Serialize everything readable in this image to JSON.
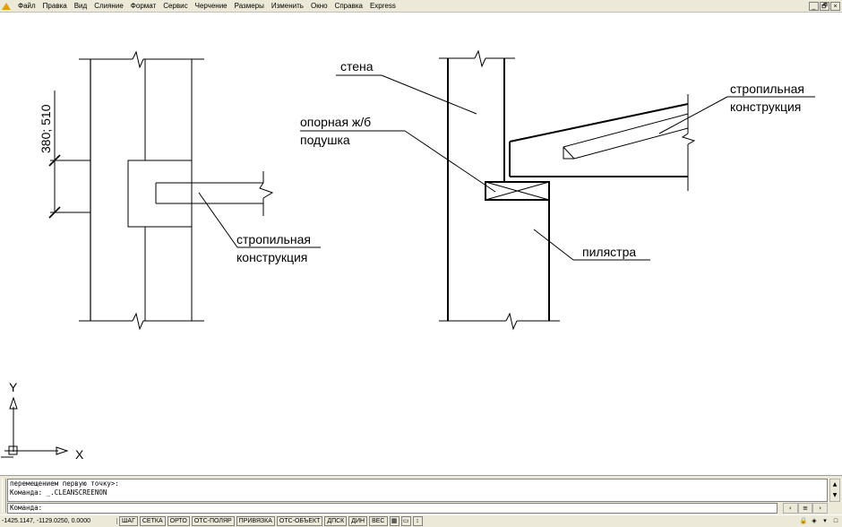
{
  "menu": {
    "items": [
      "Файл",
      "Правка",
      "Вид",
      "Слияние",
      "Формат",
      "Сервис",
      "Черчение",
      "Размеры",
      "Изменить",
      "Окно",
      "Справка",
      "Express"
    ],
    "window_controls": [
      "_",
      "🗗",
      "×"
    ]
  },
  "drawing": {
    "dimension_label": "380; 510",
    "left_label_line1": "стропильная",
    "left_label_line2": "конструкция",
    "wall_label": "стена",
    "pad_label_line1": "опорная ж/б",
    "pad_label_line2": "подушка",
    "right_label_line1": "стропильная",
    "right_label_line2": "конструкция",
    "pilaster_label": "пилястра",
    "ucs_x": "X",
    "ucs_y": "Y"
  },
  "command": {
    "history_line1": "перемещением первую точку>:",
    "history_line2": "Команда: _.CLEANSCREENON",
    "prompt": "Команда:"
  },
  "status": {
    "coordinates": "-1425.1147, -1129.0250, 0.0000",
    "toggles": [
      "ШАГ",
      "СЕТКА",
      "ОРТО",
      "ОТС-ПОЛЯР",
      "ПРИВЯЗКА",
      "ОТС-ОБЪЕКТ",
      "ДПСК",
      "ДИН",
      "ВЕС"
    ]
  }
}
